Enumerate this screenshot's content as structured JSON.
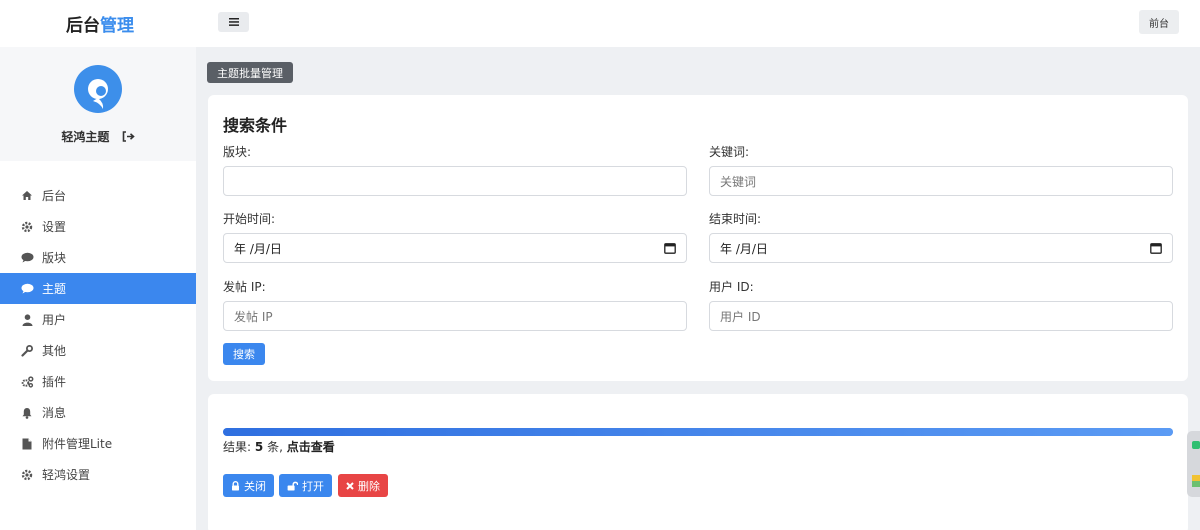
{
  "header": {
    "brand_main": "后台",
    "brand_accent": "管理",
    "front_button": "前台",
    "menu_icon": "hamburger-icon"
  },
  "sidebar": {
    "username": "轻鸿主题",
    "items": [
      {
        "label": "后台",
        "icon": "home-icon"
      },
      {
        "label": "设置",
        "icon": "gear-icon"
      },
      {
        "label": "版块",
        "icon": "comment-icon"
      },
      {
        "label": "主题",
        "icon": "comment-icon",
        "active": true
      },
      {
        "label": "用户",
        "icon": "user-icon"
      },
      {
        "label": "其他",
        "icon": "wrench-icon"
      },
      {
        "label": "插件",
        "icon": "gears-icon"
      },
      {
        "label": "消息",
        "icon": "bell-icon"
      },
      {
        "label": "附件管理Lite",
        "icon": "file-icon"
      },
      {
        "label": "轻鸿设置",
        "icon": "gear-icon"
      }
    ]
  },
  "breadcrumb": "主题批量管理",
  "search": {
    "title": "搜索条件",
    "forum_label": "版块:",
    "forum_value": "",
    "keyword_label": "关键词:",
    "keyword_placeholder": "关键词",
    "start_label": "开始时间:",
    "start_value": "年 /月/日",
    "end_label": "结束时间:",
    "end_value": "年 /月/日",
    "ip_label": "发帖 IP:",
    "ip_placeholder": "发帖 IP",
    "uid_label": "用户 ID:",
    "uid_placeholder": "用户 ID",
    "submit": "搜索"
  },
  "results": {
    "progress": 1.0,
    "prefix": "结果:",
    "count": "5",
    "unit": "条,",
    "link": "点击查看",
    "actions": [
      {
        "label": "关闭",
        "icon": "lock-icon",
        "color": "#3b87ee"
      },
      {
        "label": "打开",
        "icon": "unlock-icon",
        "color": "#3b87ee"
      },
      {
        "label": "删除",
        "icon": "close-icon",
        "color": "#e84545"
      }
    ]
  },
  "colors": {
    "accent": "#3b87ee",
    "danger": "#e84545",
    "brand_accent": "#3b8ded"
  }
}
